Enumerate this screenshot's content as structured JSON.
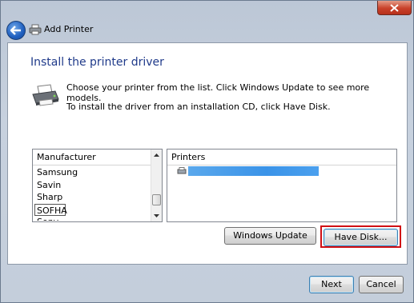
{
  "window": {
    "title": "Add Printer"
  },
  "page": {
    "heading": "Install the printer driver",
    "description_line1": "Choose your printer from the list. Click Windows Update to see more models.",
    "description_line2": "To install the driver from an installation CD, click Have Disk."
  },
  "manufacturer_list": {
    "header": "Manufacturer",
    "items": [
      "Samsung",
      "Savin",
      "Sharp",
      "SOFHA",
      "Sony"
    ],
    "selected": "SOFHA"
  },
  "printers_list": {
    "header": "Printers",
    "items": [
      ""
    ]
  },
  "buttons": {
    "windows_update": "Windows Update",
    "have_disk": "Have Disk...",
    "next": "Next",
    "cancel": "Cancel"
  },
  "colors": {
    "heading": "#1f3a8a",
    "highlight": "#d10f14",
    "selection": "#3a93e8"
  }
}
